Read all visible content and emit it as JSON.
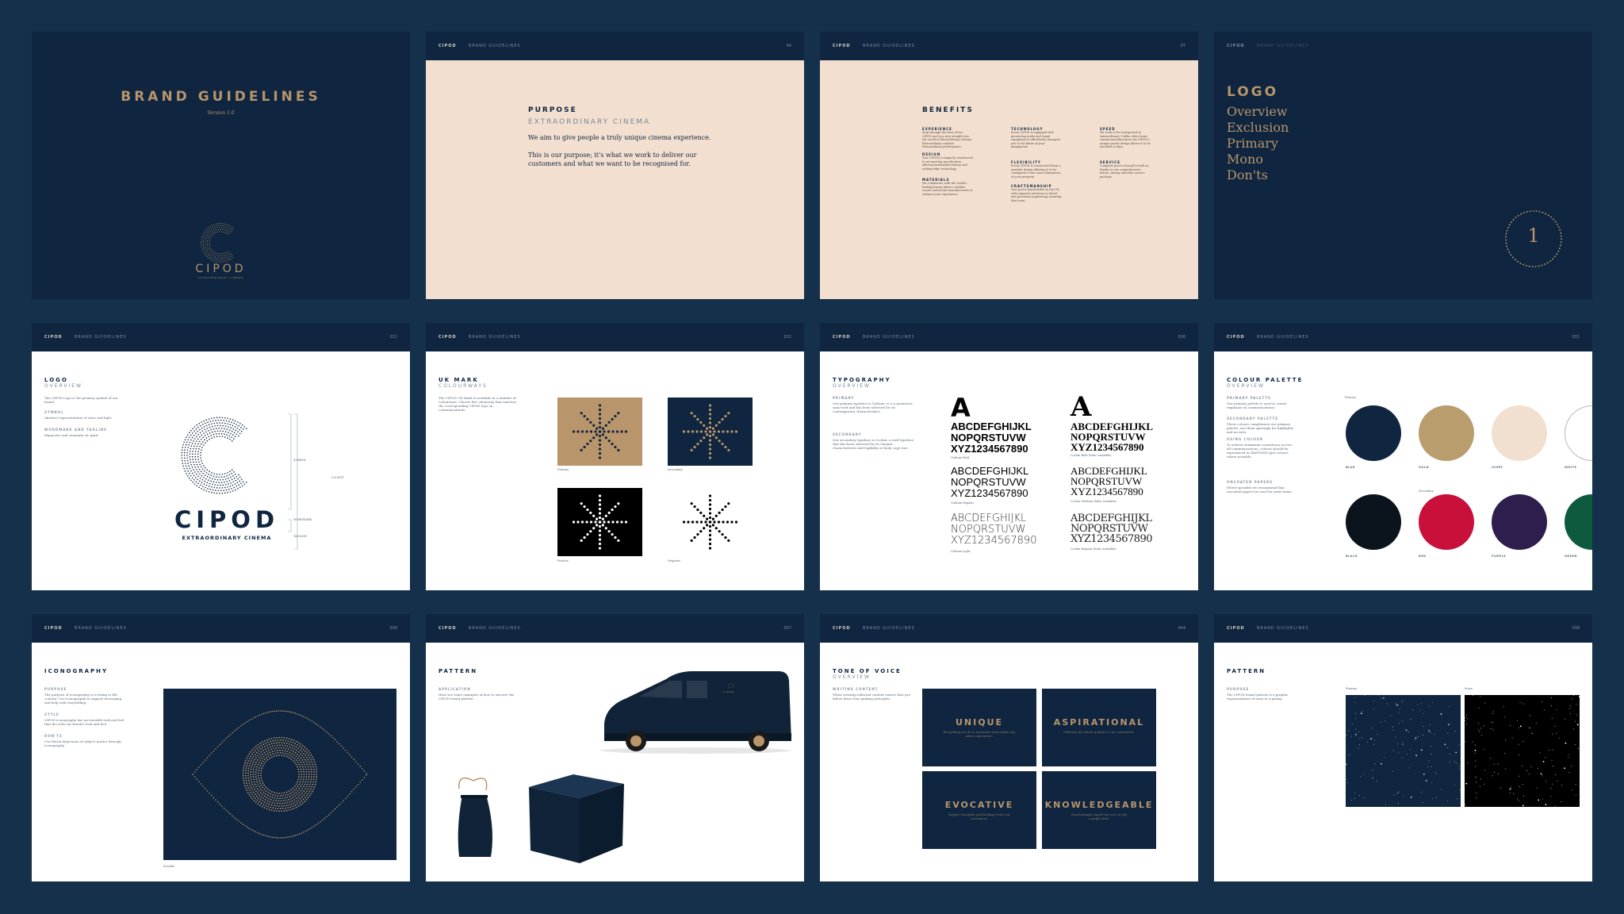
{
  "bar": {
    "brand": "CIPOD",
    "section": "BRAND GUIDELINES"
  },
  "colors": {
    "navy": "#0f2540",
    "gold": "#b8956a",
    "peach": "#f2dfcf",
    "background": "#14304a"
  },
  "cover": {
    "title": "BRAND GUIDELINES",
    "version": "Version 1.0",
    "logo": "CIPOD",
    "logo_tagline": "EXTRAORDINARY CINEMA"
  },
  "purpose": {
    "num": "04",
    "heading": "PURPOSE",
    "sub": "EXTRAORDINARY CINEMA",
    "p1": "We aim to give people a truly unique cinema experience.",
    "p2a": "This is our purpose; it's what we work to deliver our",
    "p2b": "customers and what we want to be recognised for."
  },
  "benefits": {
    "num": "07",
    "heading": "BENEFITS",
    "items": [
      {
        "title": "EXPERIENCE",
        "text": "Step through the door of our CIPOD and you step straight into the world of Extraordinary Cinema. Extraordinary comfort. Extraordinary performance."
      },
      {
        "title": "DESIGN",
        "text": "Your CIPOD is uniquely constructed to an exacting specification, offering handcrafted luxury and cutting-edge technology."
      },
      {
        "title": "MATERIALS",
        "text": "We collaborate with the world's leading luxury fabrics, textiles, woods and metals manufacturers to enhance your experience."
      },
      {
        "title": "TECHNOLOGY",
        "text": "Every CIPOD is equipped with pioneering audio and visual equipment to effortlessly transport you to the limits of your imagination."
      },
      {
        "title": "FLEXIBILITY",
        "text": "Every CIPOD is constructed from a modular design allowing it to be configured to the exact dimensions of your property."
      },
      {
        "title": "CRAFTSMANSHIP",
        "text": "Your pod is handcrafted in the UK, with exquisite attention to detail and precision engineering ensuring that room."
      },
      {
        "title": "SPEED",
        "text": "We work to be transported to extraordinary! Unlike other home cinema manufacturers the CIPOD's unique panels design allows it to be installed in days."
      },
      {
        "title": "SERVICE",
        "text": "Complete peace of mind is built in, thanks to our comprehensive before, during and after service package."
      }
    ]
  },
  "logo_menu": {
    "heading": "LOGO",
    "items": [
      "Overview",
      "Exclusion",
      "Primary",
      "Mono",
      "Don'ts"
    ],
    "chapter": "1"
  },
  "logo_overview": {
    "num": "011",
    "heading": "LOGO",
    "sub": "OVERVIEW",
    "intro": "The CIPOD Logo is the primary symbol of our brand.",
    "l1": "SYMBOL",
    "t1": "Abstract representation of stars and light.",
    "l2": "WORDMARK AND TAGLINE",
    "t2": "Expansive and cinematic in spirit.",
    "wordmark": "CIPOD",
    "tagline": "EXTRAORDINARY CINEMA",
    "a_symbol": "SYMBOL",
    "a_wordmark": "WORDMARK",
    "a_tagline": "TAGLINE",
    "a_lockup": "LOCKUP"
  },
  "uk_mark": {
    "num": "021",
    "heading": "UK MARK",
    "sub": "COLOURWAYS",
    "intro": "The CIPOD UK Mark is available in a number of colourways. Choose the colourway that matches the corresponding CIPOD logo on communications.",
    "c1": "Primary",
    "c2": "Secondary",
    "c3": "Positive",
    "c4": "Negative"
  },
  "typography": {
    "num": "026",
    "heading": "TYPOGRAPHY",
    "sub": "OVERVIEW",
    "primary_label": "PRIMARY",
    "primary_text": "Our primary typeface is Gotham; it is a geometric sans-serif and has been selected for its contemporary characteristics.",
    "secondary_label": "SECONDARY",
    "secondary_text": "Our secondary typeface is Cochin, a serif typeface that has been selected for its elegant characteristics and legibility at body copy size.",
    "big_a": "A",
    "l1": "ABCDEFGHIJKL",
    "l2": "NOPQRSTUVW",
    "l3": "XYZ1234567890",
    "n1": "Gotham Bold",
    "n2": "Gotham Regular",
    "n3": "Gotham Light",
    "m1": "Cochin Bold (Italic available)",
    "m2": "Cochin Medium (Italic available)",
    "m3": "Cochin Regular (Italic available)"
  },
  "palette": {
    "num": "031",
    "heading": "COLOUR PALETTE",
    "sub": "OVERVIEW",
    "pl": "PRIMARY PALETTE",
    "pt": "Our primary palette is used to create emphasis on communications.",
    "sl": "SECONDARY PALETTE",
    "st": "These colours complement our primary palette; use them sparingly for highlights and accents.",
    "ul": "USING COLOUR",
    "ut": "To achieve maximum consistency across all communications, colours should be reproduced as PANTONE spot colours where possible.",
    "cl": "UNCOATED PAPERS",
    "ct": "Where possible we recommend that uncoated papers be used for print items.",
    "primary_title": "Primary",
    "secondary_title": "Secondary",
    "swatches": [
      {
        "name": "BLUE",
        "hex": "#0f2540"
      },
      {
        "name": "GOLD",
        "hex": "#b99d6d"
      },
      {
        "name": "IVORY",
        "hex": "#f1dfcf"
      },
      {
        "name": "WHITE",
        "hex": "#ffffff"
      },
      {
        "name": "BLACK",
        "hex": "#0b141c"
      },
      {
        "name": "RED",
        "hex": "#c8103b"
      },
      {
        "name": "PURPLE",
        "hex": "#2e1e4e"
      },
      {
        "name": "GREEN",
        "hex": "#0d5a3c"
      }
    ]
  },
  "iconography": {
    "num": "036",
    "heading": "ICONOGRAPHY",
    "l1": "PURPOSE",
    "t1": "The purpose of iconography is to bring to life content. Use iconography to support messaging and help with storytelling.",
    "l2": "STYLE",
    "t2": "CIPOD iconography has an enviable look and feel that fits with our brand's look and feel.",
    "l3": "DON'TS",
    "t3": "Use literal depictions of subject matter through iconography.",
    "caption": "Seeable"
  },
  "pattern_app": {
    "num": "037",
    "heading": "PATTERN",
    "l1": "APPLICATION",
    "t1": "Here are some examples of how to execute the CIPOD brand pattern.",
    "van_logo": "CIPOD"
  },
  "tone": {
    "num": "044",
    "heading": "TONE OF VOICE",
    "sub": "OVERVIEW",
    "l1": "WRITING CONTENT",
    "t1": "When creating editorial content ensure that you follow these four guiding principles.",
    "boxes": [
      {
        "title": "UNIQUE",
        "text": "Everything we do is exclusive and unlike any other experience."
      },
      {
        "title": "ASPIRATIONAL",
        "text": "Offering the finest quality to our customers."
      },
      {
        "title": "EVOCATIVE",
        "text": "Inspire thoughts and feelings with our customers."
      },
      {
        "title": "KNOWLEDGEABLE",
        "text": "Reassuringly expert but not overly complicated."
      }
    ]
  },
  "pattern": {
    "num": "038",
    "heading": "PATTERN",
    "l1": "PURPOSE",
    "t1": "The CIPOD brand pattern is a graphic representation of stars in a galaxy.",
    "c1": "Primary",
    "c2": "Mono"
  }
}
